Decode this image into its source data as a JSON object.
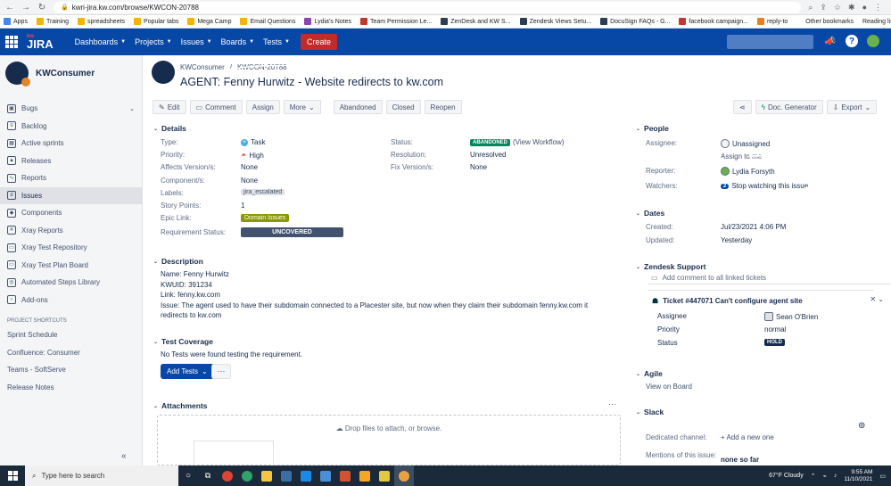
{
  "browser": {
    "url": "kwri-jira.kw.com/browse/KWCON-20788",
    "bookmarks": [
      {
        "label": "Apps",
        "color": "#4285f4"
      },
      {
        "label": "Training",
        "color": "#f4b400"
      },
      {
        "label": "spreadsheets",
        "color": "#f4b400"
      },
      {
        "label": "Popular tabs",
        "color": "#f4b400"
      },
      {
        "label": "Mega Camp",
        "color": "#f4b400"
      },
      {
        "label": "Email Questions",
        "color": "#f4b400"
      },
      {
        "label": "Lydia's Notes",
        "color": "#8e44ad"
      },
      {
        "label": "Team Permission Le...",
        "color": "#c0392b"
      },
      {
        "label": "ZenDesk and KW S...",
        "color": "#2c3e50"
      },
      {
        "label": "Zendesk Views Setu...",
        "color": "#2c3e50"
      },
      {
        "label": "DocuSign FAQs - G...",
        "color": "#2c3e50"
      },
      {
        "label": "facebook campaign...",
        "color": "#c0392b"
      },
      {
        "label": "reply-to",
        "color": "#e67e22"
      }
    ],
    "other_bookmarks": "Other bookmarks",
    "reading_list": "Reading list"
  },
  "jira_nav": {
    "logo_small": "kw",
    "logo": "JIRA",
    "menus": [
      "Dashboards",
      "Projects",
      "Issues",
      "Boards",
      "Tests"
    ],
    "create_label": "Create",
    "help_label": "?"
  },
  "sidebar": {
    "project_name": "KWConsumer",
    "items": [
      {
        "label": "Bugs",
        "icon": "bug-icon",
        "glyph": "▣",
        "right": "⌄"
      },
      {
        "label": "Backlog",
        "icon": "backlog-icon",
        "glyph": "≡",
        "right": ""
      },
      {
        "label": "Active sprints",
        "icon": "sprint-icon",
        "glyph": "▦",
        "right": ""
      },
      {
        "label": "Releases",
        "icon": "ship-icon",
        "glyph": "▲",
        "right": ""
      },
      {
        "label": "Reports",
        "icon": "chart-icon",
        "glyph": "∿",
        "right": ""
      },
      {
        "label": "Issues",
        "icon": "issues-icon",
        "glyph": "≡",
        "right": "",
        "active": true
      },
      {
        "label": "Components",
        "icon": "puzzle-icon",
        "glyph": "◆",
        "right": ""
      },
      {
        "label": "Xray Reports",
        "icon": "xray-icon",
        "glyph": "✕",
        "right": ""
      },
      {
        "label": "Xray Test Repository",
        "icon": "folder-icon",
        "glyph": "▭",
        "right": ""
      },
      {
        "label": "Xray Test Plan Board",
        "icon": "board-icon",
        "glyph": "▭",
        "right": ""
      },
      {
        "label": "Automated Steps Library",
        "icon": "library-icon",
        "glyph": "◎",
        "right": ""
      },
      {
        "label": "Add-ons",
        "icon": "chevron-right-icon",
        "glyph": "›",
        "right": ""
      }
    ],
    "shortcuts_title": "PROJECT SHORTCUTS",
    "shortcuts": [
      "Sprint Schedule",
      "Confluence: Consumer",
      "Teams - SoftServe",
      "Release Notes"
    ],
    "collapse_glyph": "«"
  },
  "issue": {
    "breadcrumb_project": "KWConsumer",
    "breadcrumb_sep": "/",
    "breadcrumb_key": "KWCON-20788",
    "title": "AGENT: Fenny Hurwitz - Website redirects to kw.com"
  },
  "toolbar": {
    "edit": "Edit",
    "comment": "Comment",
    "assign": "Assign",
    "more": "More",
    "abandoned": "Abandoned",
    "closed": "Closed",
    "reopen": "Reopen",
    "doc_generator": "Doc. Generator",
    "export": "Export"
  },
  "details": {
    "heading": "Details",
    "type_label": "Type:",
    "type_value": "Task",
    "priority_label": "Priority:",
    "priority_value": "High",
    "affects_label": "Affects Version/s:",
    "affects_value": "None",
    "components_label": "Component/s:",
    "components_value": "None",
    "labels_label": "Labels:",
    "labels_value": "jira_escalated",
    "story_points_label": "Story Points:",
    "story_points_value": "1",
    "epic_label": "Epic Link:",
    "epic_value": "Domain Issues",
    "req_status_label": "Requirement Status:",
    "req_status_value": "UNCOVERED",
    "status_label": "Status:",
    "status_value": "ABANDONED",
    "status_workflow": "(View Workflow)",
    "resolution_label": "Resolution:",
    "resolution_value": "Unresolved",
    "fix_label": "Fix Version/s:",
    "fix_value": "None"
  },
  "description": {
    "heading": "Description",
    "name": "Name: Fenny Hurwitz",
    "kwuid": "KWUID: 391234",
    "link": "Link: fenny.kw.com",
    "issue": "Issue: The agent used to have their subdomain connected to a Placester site, but now when they claim their subdomain fenny.kw.com it redirects to kw.com"
  },
  "coverage": {
    "heading": "Test Coverage",
    "text": "No Tests were found testing the requirement.",
    "add_tests": "Add Tests",
    "more": "···"
  },
  "attachments": {
    "heading": "Attachments",
    "drop_text": "Drop files to attach, or browse.",
    "menu": "···"
  },
  "people": {
    "heading": "People",
    "assignee_label": "Assignee:",
    "assignee_value": "Unassigned",
    "assign_me": "Assign to me",
    "reporter_label": "Reporter:",
    "reporter_value": "Lydia Forsyth",
    "watchers_label": "Watchers:",
    "watchers_count": "2",
    "watchers_text": "Stop watching this issue"
  },
  "dates": {
    "heading": "Dates",
    "created_label": "Created:",
    "created_value": "Jul/23/2021 4:06 PM",
    "updated_label": "Updated:",
    "updated_value": "Yesterday"
  },
  "zendesk": {
    "heading": "Zendesk Support",
    "add_comment": "Add comment to all linked tickets",
    "ticket_title": "Ticket #447071 Can't configure agent site",
    "assignee_label": "Assignee",
    "assignee_value": "Sean O'Brien",
    "priority_label": "Priority",
    "priority_value": "normal",
    "status_label": "Status",
    "status_value": "HOLD",
    "ctrl": "✕ ⌄"
  },
  "agile": {
    "heading": "Agile",
    "link": "View on Board"
  },
  "slack": {
    "heading": "Slack",
    "channel_label": "Dedicated channel:",
    "channel_value": "+ Add a new one",
    "mentions_label": "Mentions of this issue:",
    "mentions_value": "none so far"
  },
  "taskbar": {
    "search": "Type here to search",
    "weather": "67°F  Cloudy",
    "time": "9:55 AM",
    "date": "11/10/2021"
  },
  "colors": {
    "jira_blue": "#0747a6",
    "create_red": "#c32a2a",
    "annotation_white": "#ffffff"
  }
}
